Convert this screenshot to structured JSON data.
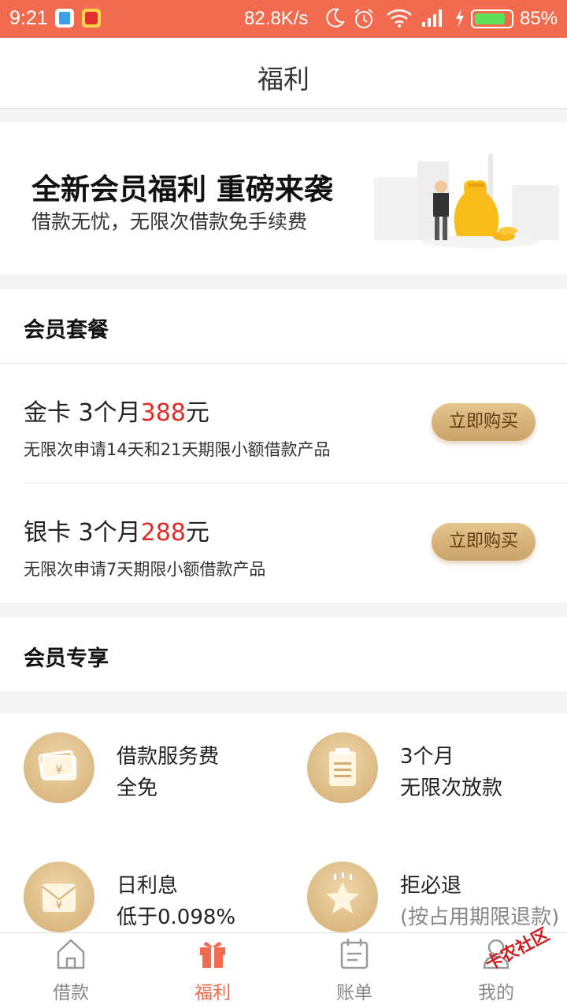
{
  "status_bar": {
    "time": "9:21",
    "network_speed": "82.8K/s",
    "battery": "85%",
    "battery_level": 0.85
  },
  "header": {
    "title": "福利"
  },
  "banner": {
    "headline": "全新会员福利 重磅来袭",
    "subline": "借款无忧，无限次借款免手续费"
  },
  "packages": {
    "section_title": "会员套餐",
    "items": [
      {
        "name": "金卡 3个月",
        "price": "388",
        "unit": "元",
        "desc": "无限次申请14天和21天期限小额借款产品",
        "button": "立即购买"
      },
      {
        "name": "银卡 3个月",
        "price": "288",
        "unit": "元",
        "desc": "无限次申请7天期限小额借款产品",
        "button": "立即购买"
      }
    ]
  },
  "exclusive": {
    "section_title": "会员专享",
    "perks": [
      {
        "line1": "借款服务费",
        "line2": "全免",
        "icon": "wallet-icon"
      },
      {
        "line1": "3个月",
        "line2": "无限次放款",
        "icon": "clipboard-icon"
      },
      {
        "line1": "日利息",
        "line2": "低于0.098%",
        "icon": "envelope-yen-icon"
      },
      {
        "line1": "拒必退",
        "line2": "(按占用期限退款)",
        "icon": "star-icon"
      }
    ]
  },
  "tabs": [
    {
      "label": "借款",
      "icon": "home-icon"
    },
    {
      "label": "福利",
      "icon": "gift-icon",
      "active": true
    },
    {
      "label": "账单",
      "icon": "calendar-icon"
    },
    {
      "label": "我的",
      "icon": "person-icon"
    }
  ],
  "watermark": "卡农社区",
  "colors": {
    "status_bar": "#f26b4f",
    "accent": "#f06a4e",
    "price_red": "#e42a20",
    "gold": "#d2ad72"
  }
}
